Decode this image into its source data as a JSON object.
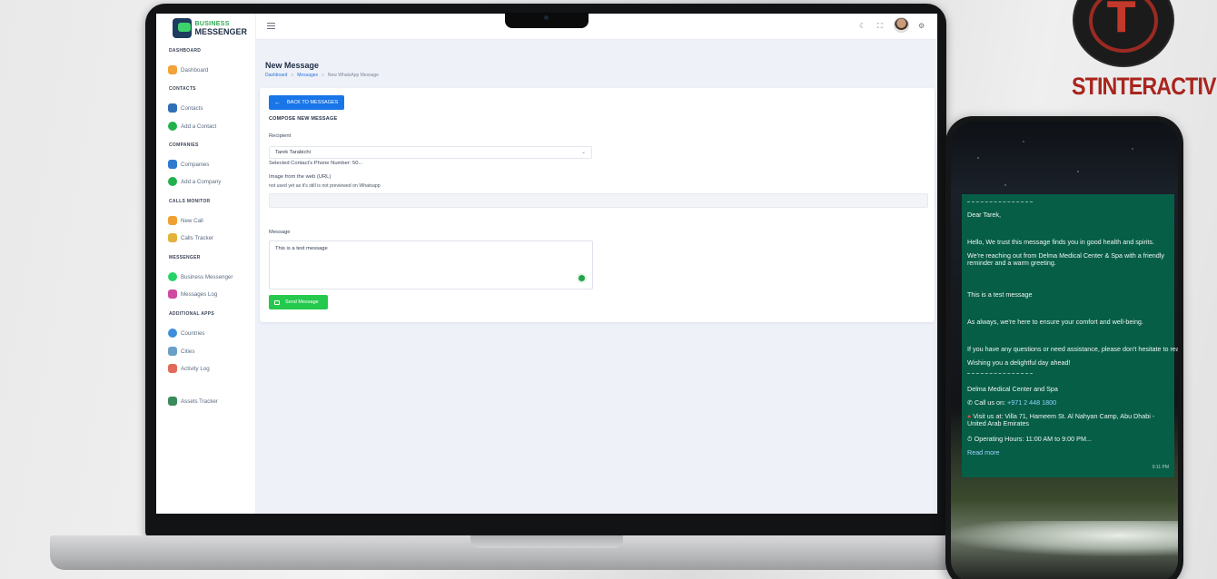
{
  "app": {
    "logo_line1": "BUSINESS",
    "logo_line2": "MESSENGER"
  },
  "sidebar": {
    "sections": [
      {
        "heading": "DASHBOARD",
        "items": [
          "Dashboard"
        ]
      },
      {
        "heading": "CONTACTS",
        "items": [
          "Contacts",
          "Add a Contact"
        ]
      },
      {
        "heading": "COMPANIES",
        "items": [
          "Companies",
          "Add a Company"
        ]
      },
      {
        "heading": "CALLS MONITOR",
        "items": [
          "New Call",
          "Calls Tracker"
        ]
      },
      {
        "heading": "MESSENGER",
        "items": [
          "Business Messenger",
          "Messages Log"
        ]
      },
      {
        "heading": "ADDITIONAL APPS",
        "items": [
          "Countries",
          "Cities",
          "Activity Log",
          "Assets Tracker"
        ]
      }
    ],
    "icon_names": [
      "dashboard-icon",
      "contacts-icon",
      "add-contact-icon",
      "companies-icon",
      "add-company-icon",
      "new-call-icon",
      "calls-tracker-icon",
      "whatsapp-icon",
      "messages-log-icon",
      "globe-icon",
      "cities-icon",
      "activity-log-icon",
      "assets-tracker-icon"
    ],
    "icon_colors": [
      "#f2a33a",
      "#2f6fb7",
      "#22b14c",
      "#2e7bd0",
      "#22b14c",
      "#f0a030",
      "#e2b23a",
      "#25d366",
      "#d04aa0",
      "#3c8fd8",
      "#6aa0c8",
      "#e36a5a",
      "#3a8a5c"
    ]
  },
  "page": {
    "title": "New Message",
    "breadcrumb": [
      "Dashboard",
      "Messages",
      "New WhatsApp Message"
    ]
  },
  "form": {
    "back_label": "BACK TO MESSAGES",
    "heading": "COMPOSE NEW MESSAGE",
    "recipient_label": "Recipient",
    "recipient_value": "Tarek Tarabichi",
    "phone_hint": "Selected Contact's Phone Number: 50...",
    "image_label": "Image from the web (URL)",
    "image_hint": "not used yet as it's still is not previewed on Whatsapp",
    "message_label": "Message",
    "message_value": "This is a test message",
    "send_label": "Send Message"
  },
  "whatsapp": {
    "greeting": "Dear Tarek,",
    "p1": "Hello, We trust this message finds you in good health and spirits.",
    "p2": "We're reaching out from Delma Medical Center & Spa with a friendly reminder and a warm greeting.",
    "p3": "This is a test message",
    "p4": "As always, we're here to ensure your comfort and well-being.",
    "p5": "If you have any questions or need assistance, please don't hesitate to reach out.",
    "p6": "Wishing you a delightful day ahead!",
    "company": "Delma Medical Center and Spa",
    "call_prefix": "Call us on: ",
    "call_number": "+971 2 448 1800",
    "visit": "Visit us at: Villa 71, Hameem St. Al Nahyan Camp, Abu Dhabi - United Arab Emirates",
    "hours": "Operating Hours: 11:00 AM to 9:00 PM...",
    "read_more": "Read more",
    "time": "9:11 PM"
  },
  "brand": {
    "mark": "T",
    "name": "STINTERACTIVE"
  },
  "colors": {
    "primary": "#1976e8",
    "success": "#25c94d",
    "whatsapp_bubble": "#075e47",
    "brand_red": "#a8251d"
  }
}
